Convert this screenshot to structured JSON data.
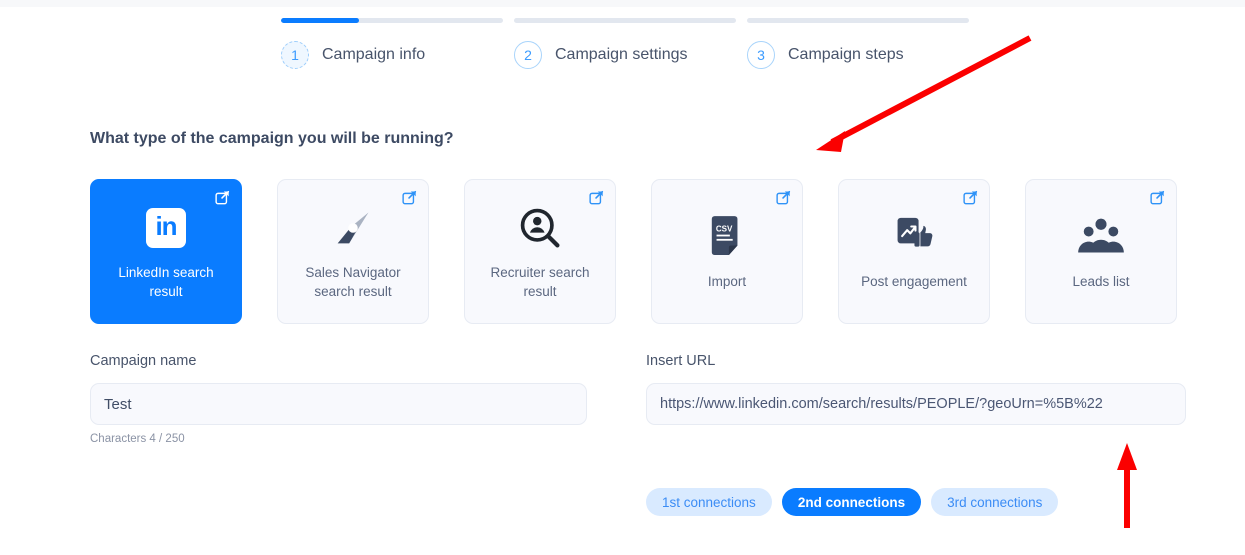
{
  "stepper": {
    "steps": [
      {
        "number": "1",
        "label": "Campaign info",
        "progress": 35,
        "state": "current"
      },
      {
        "number": "2",
        "label": "Campaign settings",
        "progress": 0,
        "state": "pending"
      },
      {
        "number": "3",
        "label": "Campaign steps",
        "progress": 0,
        "state": "pending"
      }
    ]
  },
  "main": {
    "question": "What type of the campaign you will be running?",
    "campaign_types": [
      {
        "label": "LinkedIn search result",
        "icon": "linkedin-icon",
        "selected": true
      },
      {
        "label": "Sales Navigator search result",
        "icon": "compass-icon",
        "selected": false
      },
      {
        "label": "Recruiter search result",
        "icon": "person-search-icon",
        "selected": false
      },
      {
        "label": "Import",
        "icon": "csv-file-icon",
        "selected": false
      },
      {
        "label": "Post engagement",
        "icon": "post-thumbsup-icon",
        "selected": false
      },
      {
        "label": "Leads list",
        "icon": "people-group-icon",
        "selected": false
      }
    ],
    "campaign_name": {
      "label": "Campaign name",
      "value": "Test",
      "placeholder": "Campaign name",
      "char_counter": "Characters 4 / 250"
    },
    "insert_url": {
      "label": "Insert URL",
      "value": "https://www.linkedin.com/search/results/PEOPLE/?geoUrn=%5B%22",
      "placeholder": "Insert URL"
    },
    "connections": [
      {
        "label": "1st connections",
        "active": false
      },
      {
        "label": "2nd connections",
        "active": true
      },
      {
        "label": "3rd connections",
        "active": false
      }
    ]
  },
  "colors": {
    "accent": "#0a7cff",
    "pill_inactive_bg": "#d9eaff",
    "card_bg": "#f8f9fd",
    "annotation": "#fb0000",
    "icon_dark": "#3c4a63"
  },
  "annotations": [
    {
      "name": "arrow-to-campaign-cards",
      "direction": "down-left"
    },
    {
      "name": "arrow-to-url-input",
      "direction": "up"
    }
  ]
}
